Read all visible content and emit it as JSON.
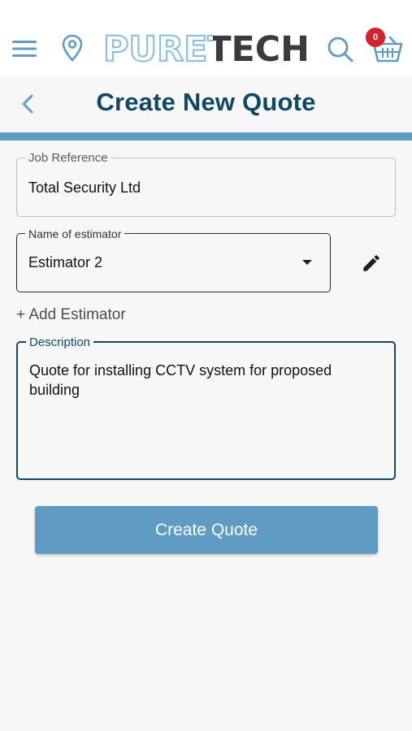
{
  "header": {
    "logo_text": "PURETECH",
    "cart_count": "0",
    "icons": [
      "menu-icon",
      "location-pin-icon",
      "search-icon",
      "basket-icon"
    ]
  },
  "page": {
    "title": "Create New Quote",
    "back_icon": "chevron-left-icon"
  },
  "form": {
    "job_reference": {
      "label": "Job Reference",
      "value": "Total Security Ltd"
    },
    "estimator": {
      "label": "Name of estimator",
      "value": "Estimator 2"
    },
    "add_estimator_label": "+ Add Estimator",
    "description": {
      "label": "Description",
      "value": "Quote for installing CCTV system for proposed building"
    },
    "submit_label": "Create Quote"
  },
  "colors": {
    "brand_dark": "#0f4764",
    "brand_light": "#5f9bc2",
    "badge": "#d2232a"
  }
}
